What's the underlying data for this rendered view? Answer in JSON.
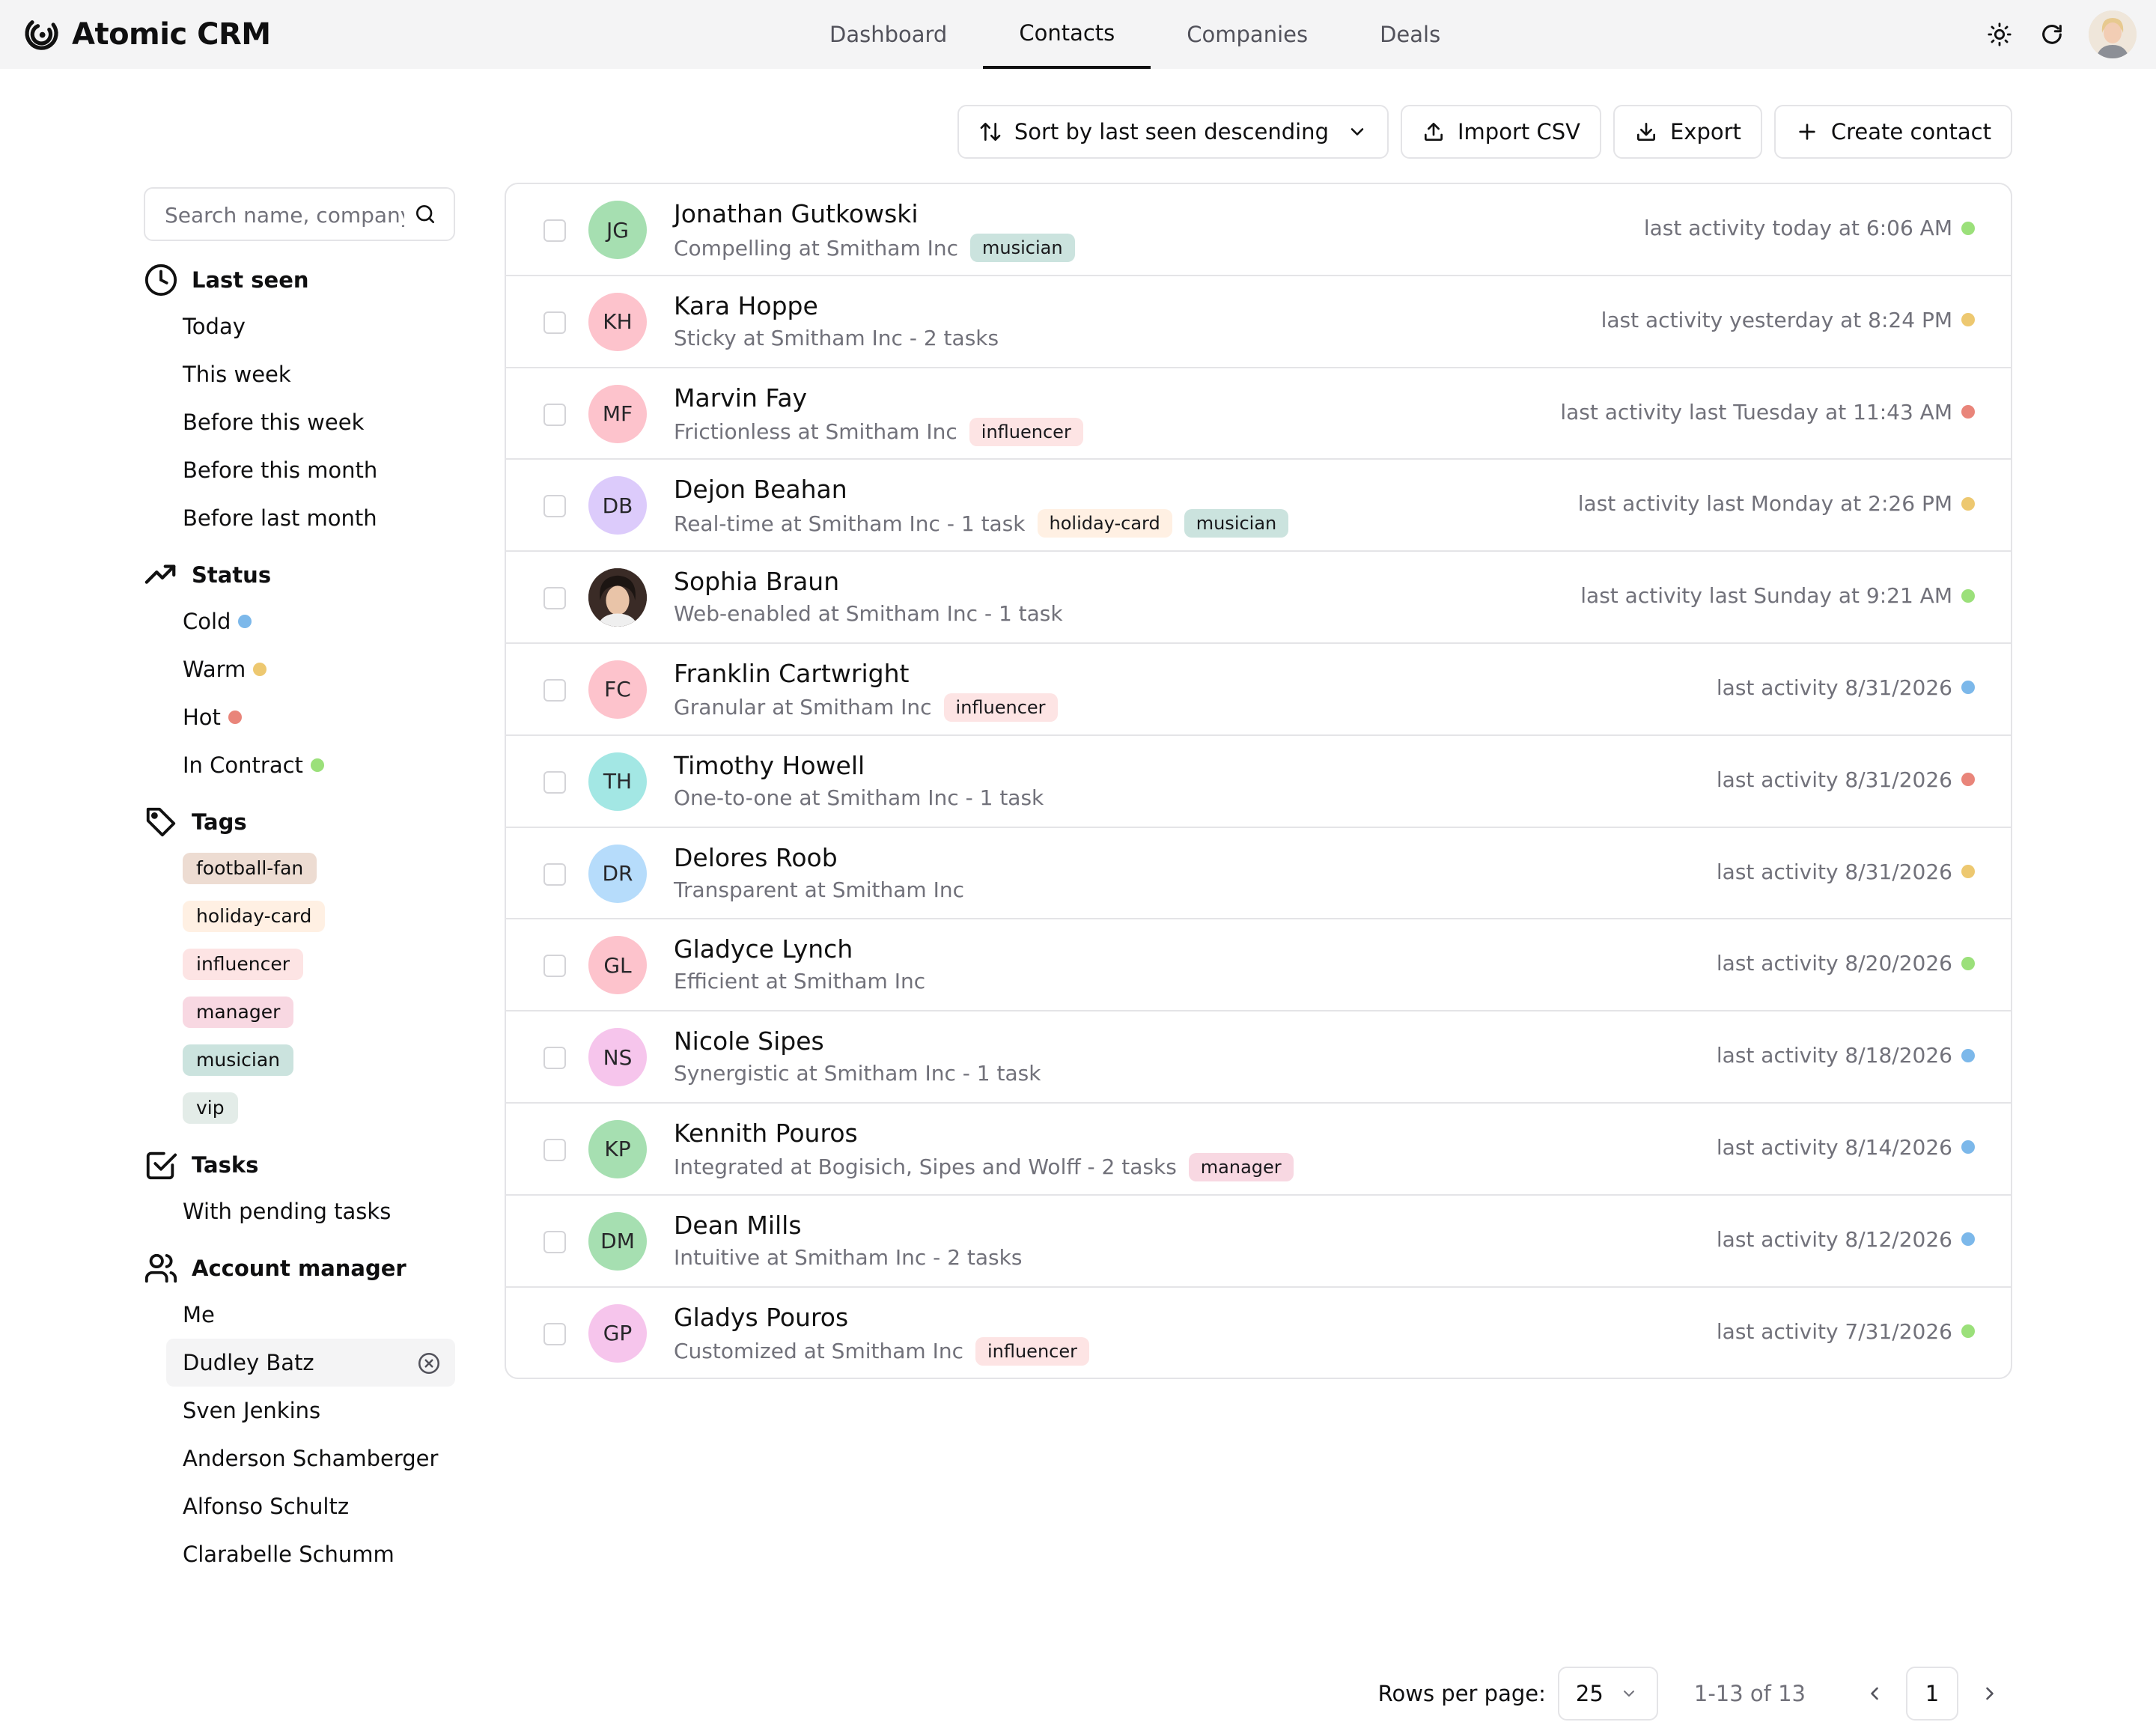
{
  "app": {
    "name": "Atomic CRM"
  },
  "nav": {
    "tabs": [
      {
        "label": "Dashboard"
      },
      {
        "label": "Contacts"
      },
      {
        "label": "Companies"
      },
      {
        "label": "Deals"
      }
    ]
  },
  "toolbar": {
    "sort_label": "Sort by last seen descending",
    "import_label": "Import CSV",
    "export_label": "Export",
    "create_label": "Create contact"
  },
  "search": {
    "placeholder": "Search name, company.."
  },
  "filters": {
    "last_seen": {
      "title": "Last seen",
      "items": [
        "Today",
        "This week",
        "Before this week",
        "Before this month",
        "Before last month"
      ]
    },
    "status": {
      "title": "Status",
      "items": [
        {
          "label": "Cold",
          "color": "#7cb8ea"
        },
        {
          "label": "Warm",
          "color": "#edc870"
        },
        {
          "label": "Hot",
          "color": "#e9857a"
        },
        {
          "label": "In Contract",
          "color": "#9be07a"
        }
      ]
    },
    "tags": {
      "title": "Tags",
      "items": [
        {
          "label": "football-fan",
          "bg": "#eddcd2"
        },
        {
          "label": "holiday-card",
          "bg": "#fff0e3"
        },
        {
          "label": "influencer",
          "bg": "#fde4e4"
        },
        {
          "label": "manager",
          "bg": "#f8d8e2"
        },
        {
          "label": "musician",
          "bg": "#cbe3de"
        },
        {
          "label": "vip",
          "bg": "#e3ece8"
        }
      ]
    },
    "tasks": {
      "title": "Tasks",
      "items": [
        "With pending tasks"
      ]
    },
    "account_manager": {
      "title": "Account manager",
      "items": [
        "Me",
        "Dudley Batz",
        "Sven Jenkins",
        "Anderson Schamberger",
        "Alfonso Schultz",
        "Clarabelle Schumm"
      ],
      "selected_index": 1
    }
  },
  "contacts": [
    {
      "initials": "JG",
      "avatar_bg": "#a6dfb1",
      "name": "Jonathan Gutkowski",
      "subtitle": "Compelling at Smitham Inc",
      "tags": [
        {
          "label": "musician",
          "bg": "#cbe3de"
        }
      ],
      "activity": "last activity today at 6:06 AM",
      "status_color": "#9be07a"
    },
    {
      "initials": "KH",
      "avatar_bg": "#fdc3cc",
      "name": "Kara Hoppe",
      "subtitle": "Sticky at Smitham Inc - 2 tasks",
      "tags": [],
      "activity": "last activity yesterday at 8:24 PM",
      "status_color": "#edc870"
    },
    {
      "initials": "MF",
      "avatar_bg": "#fdc3cc",
      "name": "Marvin Fay",
      "subtitle": "Frictionless at Smitham Inc",
      "tags": [
        {
          "label": "influencer",
          "bg": "#fde4e4"
        }
      ],
      "activity": "last activity last Tuesday at 11:43 AM",
      "status_color": "#e9857a"
    },
    {
      "initials": "DB",
      "avatar_bg": "#dccbfb",
      "name": "Dejon Beahan",
      "subtitle": "Real-time at Smitham Inc - 1 task",
      "tags": [
        {
          "label": "holiday-card",
          "bg": "#fff0e3"
        },
        {
          "label": "musician",
          "bg": "#cbe3de"
        }
      ],
      "activity": "last activity last Monday at 2:26 PM",
      "status_color": "#edc870"
    },
    {
      "initials": "",
      "avatar_bg": "#3a2b26",
      "photo": true,
      "name": "Sophia Braun",
      "subtitle": "Web-enabled at Smitham Inc - 1 task",
      "tags": [],
      "activity": "last activity last Sunday at 9:21 AM",
      "status_color": "#9be07a"
    },
    {
      "initials": "FC",
      "avatar_bg": "#fdc3cc",
      "name": "Franklin Cartwright",
      "subtitle": "Granular at Smitham Inc",
      "tags": [
        {
          "label": "influencer",
          "bg": "#fde4e4"
        }
      ],
      "activity": "last activity 8/31/2026",
      "status_color": "#7cb8ea"
    },
    {
      "initials": "TH",
      "avatar_bg": "#a3e7e4",
      "name": "Timothy Howell",
      "subtitle": "One-to-one at Smitham Inc - 1 task",
      "tags": [],
      "activity": "last activity 8/31/2026",
      "status_color": "#e9857a"
    },
    {
      "initials": "DR",
      "avatar_bg": "#b6dcfb",
      "name": "Delores Roob",
      "subtitle": "Transparent at Smitham Inc",
      "tags": [],
      "activity": "last activity 8/31/2026",
      "status_color": "#edc870"
    },
    {
      "initials": "GL",
      "avatar_bg": "#fdc3cc",
      "name": "Gladyce Lynch",
      "subtitle": "Efficient at Smitham Inc",
      "tags": [],
      "activity": "last activity 8/20/2026",
      "status_color": "#9be07a"
    },
    {
      "initials": "NS",
      "avatar_bg": "#f6c5ec",
      "name": "Nicole Sipes",
      "subtitle": "Synergistic at Smitham Inc - 1 task",
      "tags": [],
      "activity": "last activity 8/18/2026",
      "status_color": "#7cb8ea"
    },
    {
      "initials": "KP",
      "avatar_bg": "#a6dfb1",
      "name": "Kennith Pouros",
      "subtitle": "Integrated at Bogisich, Sipes and Wolff - 2 tasks",
      "tags": [
        {
          "label": "manager",
          "bg": "#f8d8e2"
        }
      ],
      "activity": "last activity 8/14/2026",
      "status_color": "#7cb8ea"
    },
    {
      "initials": "DM",
      "avatar_bg": "#a6dfb1",
      "name": "Dean Mills",
      "subtitle": "Intuitive at Smitham Inc - 2 tasks",
      "tags": [],
      "activity": "last activity 8/12/2026",
      "status_color": "#7cb8ea"
    },
    {
      "initials": "GP",
      "avatar_bg": "#f6c5ec",
      "name": "Gladys Pouros",
      "subtitle": "Customized at Smitham Inc",
      "tags": [
        {
          "label": "influencer",
          "bg": "#fde4e4"
        }
      ],
      "activity": "last activity 7/31/2026",
      "status_color": "#9be07a"
    }
  ],
  "pagination": {
    "rows_label": "Rows per page:",
    "rows_value": "25",
    "range": "1-13 of 13",
    "page": "1"
  }
}
